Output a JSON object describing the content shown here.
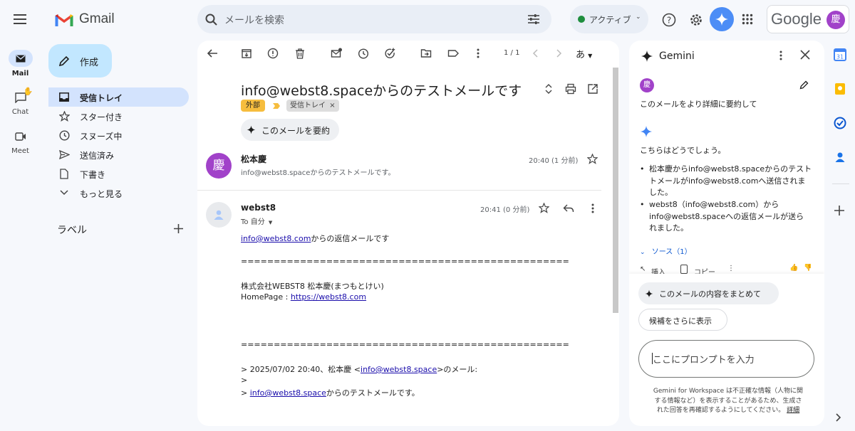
{
  "app": {
    "name": "Gmail"
  },
  "search": {
    "placeholder": "メールを検索"
  },
  "status": {
    "label": "アクティブ"
  },
  "google_brand": "Google",
  "user": {
    "avatar_char": "慶"
  },
  "left_rail": [
    {
      "label": "Mail",
      "icon": "mail-icon"
    },
    {
      "label": "Chat",
      "icon": "chat-icon"
    },
    {
      "label": "Meet",
      "icon": "meet-icon"
    }
  ],
  "compose": {
    "label": "作成"
  },
  "nav": [
    {
      "label": "受信トレイ",
      "icon": "inbox-icon",
      "active": true
    },
    {
      "label": "スター付き",
      "icon": "star-icon"
    },
    {
      "label": "スヌーズ中",
      "icon": "clock-icon"
    },
    {
      "label": "送信済み",
      "icon": "send-icon"
    },
    {
      "label": "下書き",
      "icon": "draft-icon"
    },
    {
      "label": "もっと見る",
      "icon": "chevron-down-icon"
    }
  ],
  "labels": {
    "title": "ラベル"
  },
  "toolbar": {
    "pagination": "1 / 1",
    "input_tool": "あ"
  },
  "email": {
    "subject": "info@webst8.spaceからのテストメールです",
    "tag_external": "外部",
    "tag_inbox": "受信トレイ",
    "tag_remove": "×",
    "summarize_label": "このメールを要約",
    "messages": [
      {
        "sender": "松本慶",
        "avatar_char": "慶",
        "snippet": "info@webst8.spaceからのテストメールです。",
        "time": "20:40 (1 分前)"
      },
      {
        "sender": "webst8",
        "to": "To 自分",
        "time": "20:41 (0 分前)",
        "body": {
          "line1_link": "info@webst8.com",
          "line1_rest": "からの返信メールです",
          "separator": "==================================================",
          "company": "株式会社WEBST8 松本慶(まつもとけい)",
          "homepage_label": "HomePage : ",
          "homepage_link": "https://webst8.com",
          "separator2": "==================================================",
          "quote1_pre": "> 2025/07/02 20:40、松本慶 <",
          "quote1_link": "info@webst8.space",
          "quote1_post": ">のメール:",
          "quote2": ">",
          "quote3_pre": "> ",
          "quote3_link": "info@webst8.space",
          "quote3_post": "からのテストメールです。"
        }
      }
    ]
  },
  "gemini": {
    "title": "Gemini",
    "user_avatar_char": "慶",
    "user_prompt": "このメールをより詳細に要約して",
    "reply_intro": "こちらはどうでしょう。",
    "bullet1_l1": "松本慶からinfo@webst8.spaceからのテスト",
    "bullet1_l2": "トメールがinfo@webst8.comへ送信されま",
    "bullet1_l3": "した。",
    "bullet2_l1": "webst8（info@webst8.com）から",
    "bullet2_l2": "info@webst8.spaceへの返信メールが送ら",
    "bullet2_l3": "れました。",
    "sources": "ソース（1）",
    "insert": "挿入",
    "copy": "コピー",
    "suggestion1": "このメールの内容をまとめて",
    "suggestion2": "候補をさらに表示",
    "prompt_placeholder": "ここにプロンプトを入力",
    "disclaimer_l1": "Gemini for Workspace は不正確な情報（人物に関",
    "disclaimer_l2": "する情報など）を表示することがあるため、生成さ",
    "disclaimer_l3": "れた回答を再確認するようにしてください。",
    "disclaimer_link": "詳細"
  },
  "colors": {
    "accent": "#0b57d0",
    "compose_bg": "#c2e7ff",
    "active_nav": "#d3e3fd",
    "avatar": "#a142c9",
    "tag_external": "#f6bd3e"
  }
}
